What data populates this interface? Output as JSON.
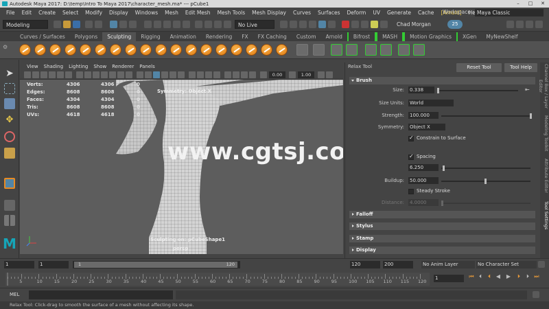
{
  "window": {
    "title": "Autodesk Maya 2017: D:\\temp\\Intro To Maya 2017\\character_mesh.ma*   ---   pCube1"
  },
  "menubar": {
    "items": [
      "File",
      "Edit",
      "Create",
      "Select",
      "Modify",
      "Display",
      "Windows",
      "Mesh",
      "Edit Mesh",
      "Mesh Tools",
      "Mesh Display",
      "Curves",
      "Surfaces",
      "Deform",
      "UV",
      "Generate",
      "Cache",
      "[Arnold]",
      "Help"
    ],
    "workspace_label": "Workspace :",
    "workspace_value": "Maya Classic"
  },
  "statusline": {
    "mode": "Modeling",
    "live_surface": "No Live Surface",
    "user": "Chad Morgan",
    "notifications": "25"
  },
  "shelf": {
    "tabs": [
      "Curves / Surfaces",
      "Polygons",
      "Sculpting",
      "Rigging",
      "Animation",
      "Rendering",
      "FX",
      "FX Caching",
      "Custom",
      "Arnold",
      "Bifrost",
      "MASH",
      "Motion Graphics",
      "XGen",
      "MyNewShelf"
    ],
    "active_tab": "Sculpting"
  },
  "viewport": {
    "menu": [
      "View",
      "Shading",
      "Lighting",
      "Show",
      "Renderer",
      "Panels"
    ],
    "exposure": "0.00",
    "gamma": "1.00",
    "hud": [
      {
        "label": "Verts:",
        "v1": "4306",
        "v2": "4306",
        "v3": "0"
      },
      {
        "label": "Edges:",
        "v1": "8608",
        "v2": "8608",
        "v3": "0"
      },
      {
        "label": "Faces:",
        "v1": "4304",
        "v2": "4304",
        "v3": "0"
      },
      {
        "label": "Tris:",
        "v1": "8608",
        "v2": "8608",
        "v3": "0"
      },
      {
        "label": "UVs:",
        "v1": "4618",
        "v2": "4618",
        "v3": "0"
      }
    ],
    "symmetry": "Symmetry: Object X",
    "sculpting_on": "Sculpting on: pCubeShape1",
    "camera": "persp",
    "watermark": "www.cgtsj.com"
  },
  "tool_settings": {
    "title": "Relax Tool",
    "reset_label": "Reset Tool",
    "help_label": "Tool Help",
    "brush_section": "Brush",
    "size_label": "Size:",
    "size_value": "0.338",
    "size_units_label": "Size Units:",
    "size_units_value": "World",
    "strength_label": "Strength:",
    "strength_value": "100.000",
    "symmetry_label": "Symmetry:",
    "symmetry_value": "Object X",
    "constrain_label": "Constrain to Surface",
    "spacing_label": "Spacing",
    "spacing_value": "6.250",
    "buildup_label": "Buildup:",
    "buildup_value": "50.000",
    "steady_label": "Steady Stroke",
    "distance_label": "Distance:",
    "distance_value": "4.0000",
    "sections": [
      "Falloff",
      "Stylus",
      "Stamp",
      "Display"
    ]
  },
  "side_tabs": [
    "Channel Box / Layer Editor",
    "Modeling Toolkit",
    "Attribute Editor",
    "Tool Settings"
  ],
  "range": {
    "start": "1",
    "start_inner": "1",
    "slider_start": "1",
    "slider_end": "120",
    "end_inner": "120",
    "end": "200",
    "anim_layer": "No Anim Layer",
    "char_set": "No Character Set"
  },
  "timeline": {
    "ticks": [
      "5",
      "10",
      "15",
      "20",
      "25",
      "30",
      "35",
      "40",
      "45",
      "50",
      "55",
      "60",
      "65",
      "70",
      "75",
      "80",
      "85",
      "90",
      "95",
      "100",
      "105",
      "110",
      "115",
      "120"
    ],
    "current": "1"
  },
  "command": {
    "label": "MEL"
  },
  "help_line": "Relax Tool: Click-drag to smooth the surface of a mesh without affecting its shape.",
  "colors": {
    "accent": "#5285a6",
    "shelf_orange": "#e88a22",
    "highlight": "#e8c84a"
  }
}
